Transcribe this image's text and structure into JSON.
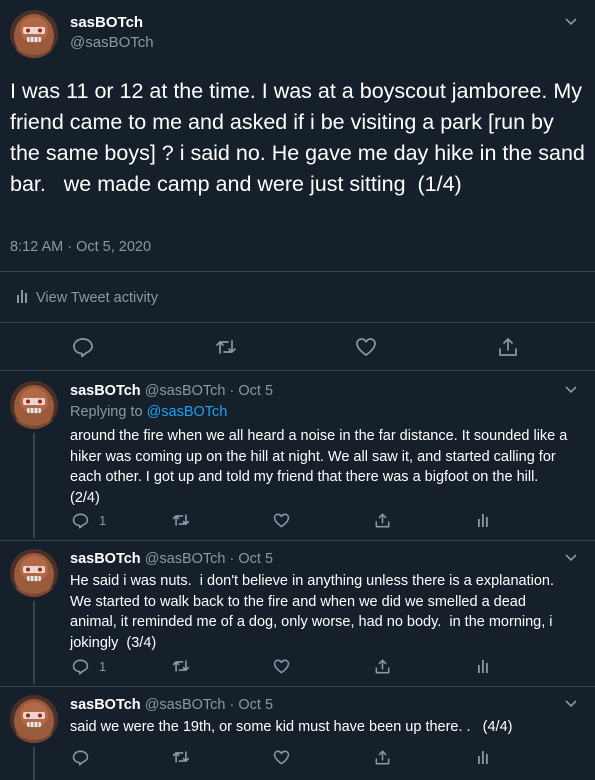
{
  "main_tweet": {
    "name": "sasBOTch",
    "handle": "@sasBOTch",
    "text": "I was 11 or 12 at the time. I was at a boyscout jamboree. My friend came to me and asked if i be visiting a park [run by the same boys] ? i said no. He gave me day hike in the sand bar.   we made camp and were just sitting  (1/4)",
    "timestamp": "8:12 AM · Oct 5, 2020",
    "activity_label": "View Tweet activity",
    "icons": [
      "reply-icon",
      "retweet-icon",
      "like-icon",
      "share-icon"
    ]
  },
  "replies": [
    {
      "name": "sasBOTch",
      "handle_date": "@sasBOTch · Oct 5",
      "replying_prefix": "Replying to ",
      "replying_to": "@sasBOTch",
      "text": "around the fire when we all heard a noise in the far distance. It sounded like a hiker was coming up on the hill at night. We all saw it, and started calling for each other. I got up and told my friend that there was a bigfoot on the hill.  (2/4)",
      "reply_count": "1"
    },
    {
      "name": "sasBOTch",
      "handle_date": "@sasBOTch · Oct 5",
      "text": "He said i was nuts.  i don't believe in anything unless there is a explanation. We started to walk back to the fire and when we did we smelled a dead animal, it reminded me of a dog, only worse, had no body.  in the morning, i jokingly  (3/4)",
      "reply_count": "1"
    },
    {
      "name": "sasBOTch",
      "handle_date": "@sasBOTch · Oct 5",
      "text": "said we were the 19th, or some kid must have been up there. .   (4/4)",
      "reply_count": ""
    }
  ],
  "colors": {
    "background": "#15202b",
    "muted": "#8899a6",
    "link": "#1da1f2",
    "divider": "#38444d"
  }
}
